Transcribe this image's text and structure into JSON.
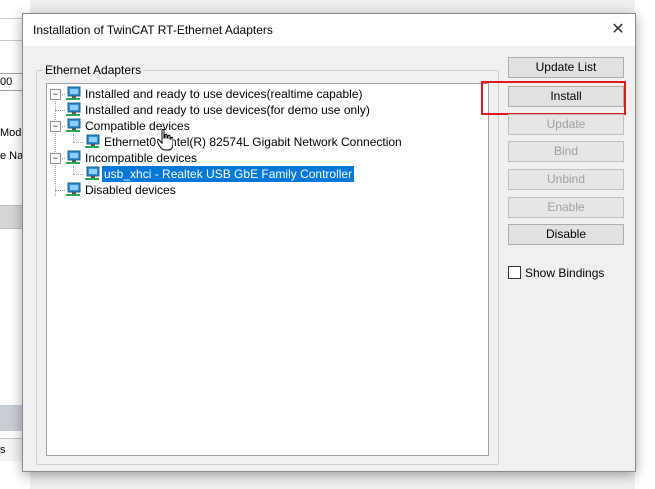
{
  "background_app": {
    "field_value": "00",
    "label_1": "Mode",
    "label_2": "e Nam",
    "bottom_tab": "s"
  },
  "dialog": {
    "title": "Installation of TwinCAT RT-Ethernet Adapters",
    "close_glyph": "✕",
    "group_label": "Ethernet Adapters",
    "tree": [
      {
        "label": "Installed and ready to use devices(realtime capable)",
        "expander": "−"
      },
      {
        "label": "Installed and ready to use devices(for demo use only)",
        "expander": ""
      },
      {
        "label": "Compatible devices",
        "expander": "−"
      },
      {
        "label": "Ethernet0 - Intel(R) 82574L Gigabit Network Connection",
        "expander": ""
      },
      {
        "label": "Incompatible devices",
        "expander": "−"
      },
      {
        "label": "usb_xhci - Realtek USB GbE Family Controller",
        "expander": "",
        "selected": true
      },
      {
        "label": "Disabled devices",
        "expander": ""
      }
    ],
    "buttons": {
      "update_list": "Update List",
      "install": "Install",
      "update": "Update",
      "bind": "Bind",
      "unbind": "Unbind",
      "enable": "Enable",
      "disable": "Disable"
    },
    "show_bindings": {
      "label": "Show Bindings",
      "checked": false
    }
  },
  "colors": {
    "selection": "#0078d7",
    "highlight_box": "#e0191f",
    "network_icon": "#2f8fd6"
  },
  "icons": [
    "network-adapter-icon",
    "close-icon",
    "hand-cursor-icon"
  ]
}
